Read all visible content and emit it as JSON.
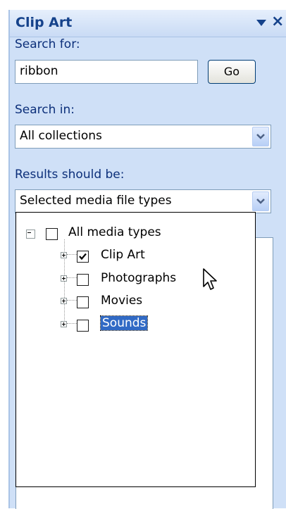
{
  "pane": {
    "title": "Clip Art",
    "close_glyph": "×"
  },
  "search": {
    "label": "Search for:",
    "value": "ribbon",
    "go_label": "Go"
  },
  "search_in": {
    "label": "Search in:",
    "value": "All collections"
  },
  "results": {
    "label": "Results should be:",
    "value": "Selected media file types"
  },
  "tree": {
    "root": {
      "label": "All media types",
      "checked": false,
      "expanded": true
    },
    "items": [
      {
        "label": "Clip Art",
        "checked": true,
        "selected": false
      },
      {
        "label": "Photographs",
        "checked": false,
        "selected": false
      },
      {
        "label": "Movies",
        "checked": false,
        "selected": false
      },
      {
        "label": "Sounds",
        "checked": false,
        "selected": true
      }
    ]
  },
  "colors": {
    "pane_bg": "#cfe0f7",
    "title_text": "#15428b",
    "label_text": "#0c2f7a",
    "selection": "#316ac5"
  },
  "icons": {
    "dropdown": "chevron-down-icon",
    "close": "close-icon",
    "menu": "triangle-down-icon",
    "cursor": "mouse-pointer-icon"
  }
}
